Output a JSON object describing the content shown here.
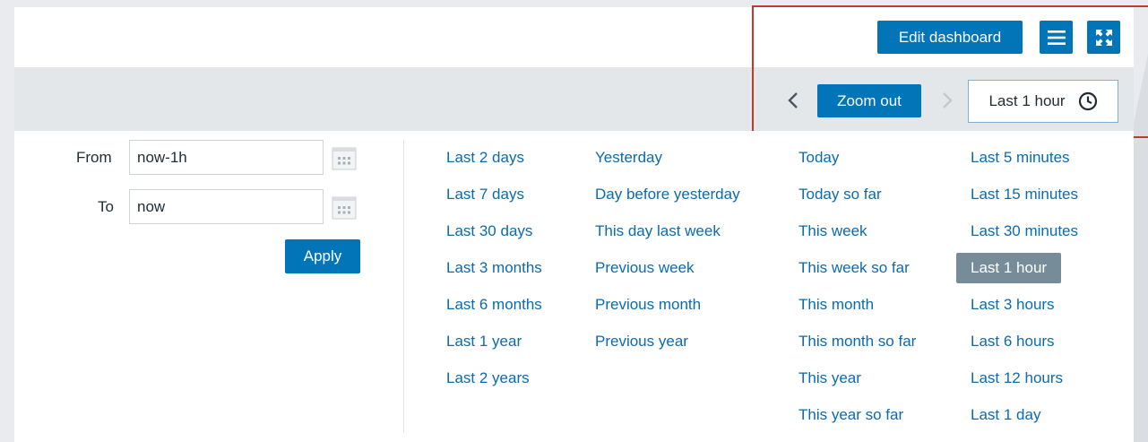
{
  "header": {
    "edit_dashboard_label": "Edit dashboard",
    "menu_icon": "hamburger-menu-icon",
    "fullscreen_icon": "fullscreen-icon"
  },
  "timebar": {
    "zoom_out_label": "Zoom out",
    "selected_period": "Last 1 hour",
    "clock_icon": "clock-icon"
  },
  "form": {
    "from_label": "From",
    "from_value": "now-1h",
    "to_label": "To",
    "to_value": "now",
    "apply_label": "Apply"
  },
  "quick_ranges": {
    "col1": [
      "Last 2 days",
      "Last 7 days",
      "Last 30 days",
      "Last 3 months",
      "Last 6 months",
      "Last 1 year",
      "Last 2 years"
    ],
    "col2": [
      "Yesterday",
      "Day before yesterday",
      "This day last week",
      "Previous week",
      "Previous month",
      "Previous year"
    ],
    "col3": [
      "Today",
      "Today so far",
      "This week",
      "This week so far",
      "This month",
      "This month so far",
      "This year",
      "This year so far"
    ],
    "col4": [
      "Last 5 minutes",
      "Last 15 minutes",
      "Last 30 minutes",
      "Last 1 hour",
      "Last 3 hours",
      "Last 6 hours",
      "Last 12 hours",
      "Last 1 day"
    ],
    "active": "Last 1 hour"
  },
  "colors": {
    "primary": "#0275b8",
    "link": "#0a6bb0",
    "active_bg": "#768d99",
    "annotation": "#c0392b"
  }
}
